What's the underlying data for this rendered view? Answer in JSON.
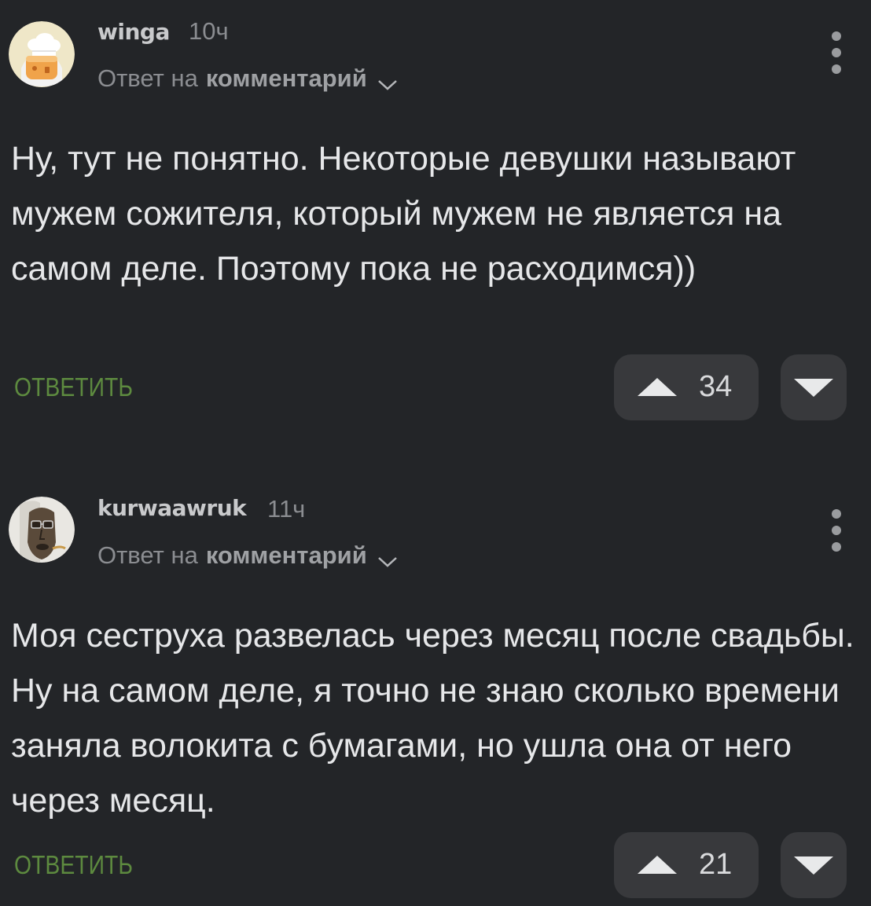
{
  "comments": [
    {
      "username": "winga",
      "time": "10ч",
      "reply_prefix": "Ответ на",
      "reply_link": "комментарий",
      "text": "Ну, тут не понятно. Некоторые девушки называют мужем сожителя, который мужем не является на самом деле. Поэтому пока не расходимся))",
      "reply_label": "ОТВЕТИТЬ",
      "rating": "34",
      "avatar_icon": "chef-hat-cake-avatar",
      "accent_color": "#5d8a3f"
    },
    {
      "username": "kurwaawruk",
      "time": "11ч",
      "reply_prefix": "Ответ на",
      "reply_link": "комментарий",
      "text": "Моя сеструха развелась через месяц после свадьбы. Ну на самом деле, я точно не знаю сколько времени заняла волокита с бумагами, но ушла она от него через месяц.",
      "reply_label": "ОТВЕТИТЬ",
      "rating": "21",
      "avatar_icon": "wooden-mask-avatar",
      "accent_color": "#5d8a3f"
    }
  ]
}
